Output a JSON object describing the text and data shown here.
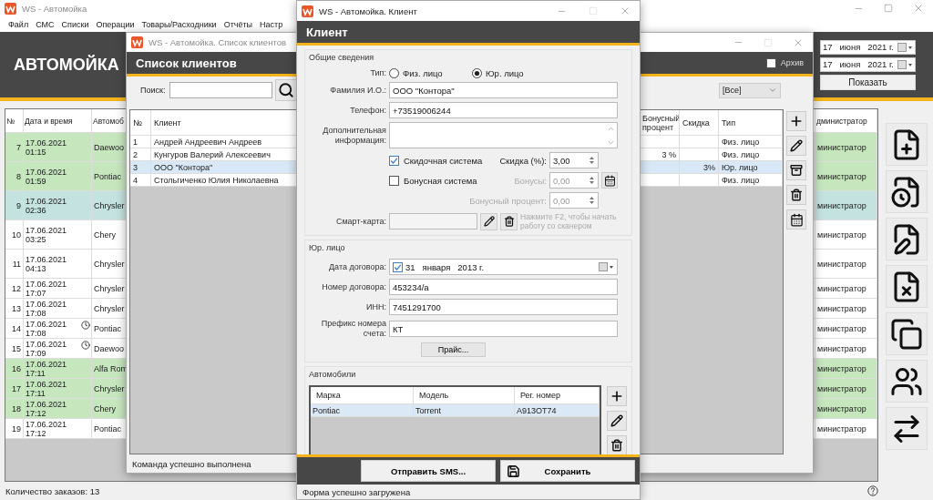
{
  "main_window": {
    "title": "WS - Автомойка",
    "menu": [
      "Файл",
      "СМС",
      "Списки",
      "Операции",
      "Товары/Расходники",
      "Отчёты",
      "Настр"
    ],
    "header": "АВТОМОЙКА",
    "date_from": "17   июня   2021 г.",
    "date_to": "17   июня   2021 г.",
    "show_button": "Показать",
    "columns": [
      "№",
      "Дата и время",
      "Автомоб",
      "дминистратор"
    ],
    "rows": [
      {
        "number": "7",
        "date": "17.06.2021",
        "time": "01:15",
        "car": "Daewoo",
        "admin": "министратор",
        "color": "#c6e6be",
        "scheduled": false
      },
      {
        "number": "8",
        "date": "17.06.2021",
        "time": "01:59",
        "car": "Pontiac",
        "admin": "министратор",
        "color": "#c6e6be",
        "scheduled": false
      },
      {
        "number": "9",
        "date": "17.06.2021",
        "time": "02:36",
        "car": "Chrysler",
        "admin": "министратор",
        "color": "#c4e2df",
        "scheduled": false
      },
      {
        "number": "10",
        "date": "17.06.2021",
        "time": "03:25",
        "car": "Chery",
        "admin": "министратор",
        "color": "#ffffff",
        "scheduled": false
      },
      {
        "number": "11",
        "date": "17.06.2021",
        "time": "04:13",
        "car": "Chrysler",
        "admin": "министратор",
        "color": "#ffffff",
        "scheduled": false
      },
      {
        "number": "12",
        "date": "17.06.2021",
        "time": "17:07",
        "car": "Chrysler",
        "admin": "министратор",
        "color": "#ffffff",
        "scheduled": false
      },
      {
        "number": "13",
        "date": "17.06.2021",
        "time": "17:08",
        "car": "Chrysler",
        "admin": "министратор",
        "color": "#ffffff",
        "scheduled": false
      },
      {
        "number": "14",
        "date": "17.06.2021",
        "time": "17:08",
        "car": "Pontiac",
        "admin": "министратор",
        "color": "#ffffff",
        "scheduled": true
      },
      {
        "number": "15",
        "date": "17.06.2021",
        "time": "17:09",
        "car": "Daewoo",
        "admin": "министратор",
        "color": "#ffffff",
        "scheduled": true
      },
      {
        "number": "16",
        "date": "17.06.2021",
        "time": "17:11",
        "car": "Alfa Rom",
        "admin": "министратор",
        "color": "#c6e6be",
        "scheduled": false
      },
      {
        "number": "17",
        "date": "17.06.2021",
        "time": "17:11",
        "car": "Chrysler",
        "admin": "министратор",
        "color": "#c6e6be",
        "scheduled": false
      },
      {
        "number": "18",
        "date": "17.06.2021",
        "time": "17:12",
        "car": "Chery",
        "admin": "министратор",
        "color": "#c6e6be",
        "scheduled": false
      },
      {
        "number": "19",
        "date": "17.06.2021",
        "time": "17:12",
        "car": "Pontiac",
        "admin": "министратор",
        "color": "#ffffff",
        "scheduled": false
      }
    ],
    "status": "Количество заказов: 13"
  },
  "clients_window": {
    "title": "WS - Автомойка. Список клиентов",
    "header": "Список клиентов",
    "archive": {
      "label": "Архив",
      "checked": false
    },
    "search_label": "Поиск:",
    "filter": "[Все]",
    "columns": [
      "№",
      "Клиент",
      "Бонусный процент",
      "Скидка",
      "Тип"
    ],
    "rows": [
      {
        "number": "1",
        "name": "Андрей Андреевич Андреев",
        "type": "Физ. лицо",
        "selected": false
      },
      {
        "number": "2",
        "name": "Кунгуров Валерий Алексеевич",
        "bonus_percent": "3 %",
        "type": "Физ. лицо",
        "selected": false
      },
      {
        "number": "3",
        "name": "ООО \"Контора\"",
        "discount": "3%",
        "type": "Юр. лицо",
        "selected": true
      },
      {
        "number": "4",
        "name": "Стольгиченко Юлия Николаевна",
        "type": "Физ. лицо",
        "selected": false
      }
    ],
    "status": "Команда успешно выполнена"
  },
  "client_dialog": {
    "title": "WS - Автомойка. Клиент",
    "header": "Клиент",
    "general_group": "Общие сведения",
    "type_label": "Тип:",
    "types": [
      {
        "label": "Физ. лицо",
        "selected": false
      },
      {
        "label": "Юр. лицо",
        "selected": true
      }
    ],
    "name_label": "Фамилия И.О.:",
    "name": "ООО \"Контора\"",
    "phone_label": "Телефон:",
    "phone": "+73519006244",
    "info_label": "Дополнительная информация:",
    "discount_system": {
      "label": "Скидочная система",
      "checked": true
    },
    "discount_label": "Скидка (%):",
    "discount": "3,00",
    "bonus_system": {
      "label": "Бонусная система",
      "checked": false
    },
    "bonuses_label": "Бонусы:",
    "bonuses": "0,00",
    "bonus_percent_label": "Бонусный процент:",
    "bonus_percent": "0,00",
    "card_label": "Смарт-карта:",
    "card_hint": "Нажмите F2, чтобы начать работу со сканером",
    "legal_group": "Юр. лицо",
    "contract_date_label": "Дата договора:",
    "contract_date": "31   января   2013 г.",
    "contract_date_checked": true,
    "contract_number_label": "Номер договора:",
    "contract_number": "453234/а",
    "inn_label": "ИНН:",
    "inn": "7451291700",
    "prefix_label": "Префикс номера счета:",
    "prefix": "КТ",
    "price_button": "Прайс...",
    "cars_group": "Автомобили",
    "car_columns": [
      "Марка",
      "Модель",
      "Рег. номер"
    ],
    "cars": [
      {
        "make": "Pontiac",
        "model": "Torrent",
        "plate": "А913ОТ74",
        "selected": true
      }
    ],
    "sms_button": "Отправить SMS...",
    "save_button": "Сохранить",
    "status": "Форма успешно загружена"
  }
}
